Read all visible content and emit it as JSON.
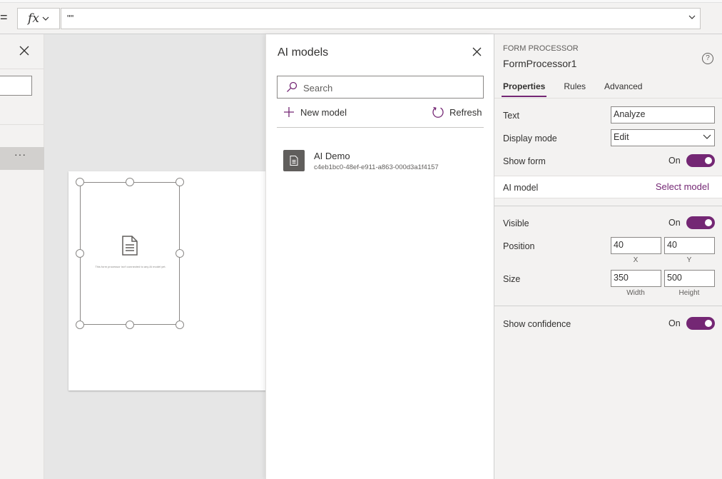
{
  "formula_bar": {
    "equals": "=",
    "fx_label": "fx",
    "formula": "\"\""
  },
  "left_panel": {
    "more_label": "···"
  },
  "canvas": {
    "form_message": "This form processor isn't connected to any AI model yet."
  },
  "ai_models_panel": {
    "title": "AI models",
    "search_placeholder": "Search",
    "new_model_label": "New model",
    "refresh_label": "Refresh",
    "models": [
      {
        "name": "AI Demo",
        "id": "c4eb1bc0-48ef-e911-a863-000d3a1f4157"
      }
    ]
  },
  "properties_panel": {
    "control_type": "FORM PROCESSOR",
    "control_name": "FormProcessor1",
    "help_glyph": "?",
    "tabs": [
      "Properties",
      "Rules",
      "Advanced"
    ],
    "text": {
      "label": "Text",
      "value": "Analyze"
    },
    "display_mode": {
      "label": "Display mode",
      "value": "Edit"
    },
    "show_form": {
      "label": "Show form",
      "state": "On"
    },
    "ai_model": {
      "label": "AI model",
      "link": "Select model"
    },
    "visible": {
      "label": "Visible",
      "state": "On"
    },
    "position": {
      "label": "Position",
      "x": "40",
      "y": "40",
      "x_label": "X",
      "y_label": "Y"
    },
    "size": {
      "label": "Size",
      "width": "350",
      "height": "500",
      "width_label": "Width",
      "height_label": "Height"
    },
    "show_confidence": {
      "label": "Show confidence",
      "state": "On"
    }
  },
  "colors": {
    "accent": "#742774",
    "panel_bg": "#f3f2f1",
    "canvas_bg": "#e6e6e6"
  }
}
